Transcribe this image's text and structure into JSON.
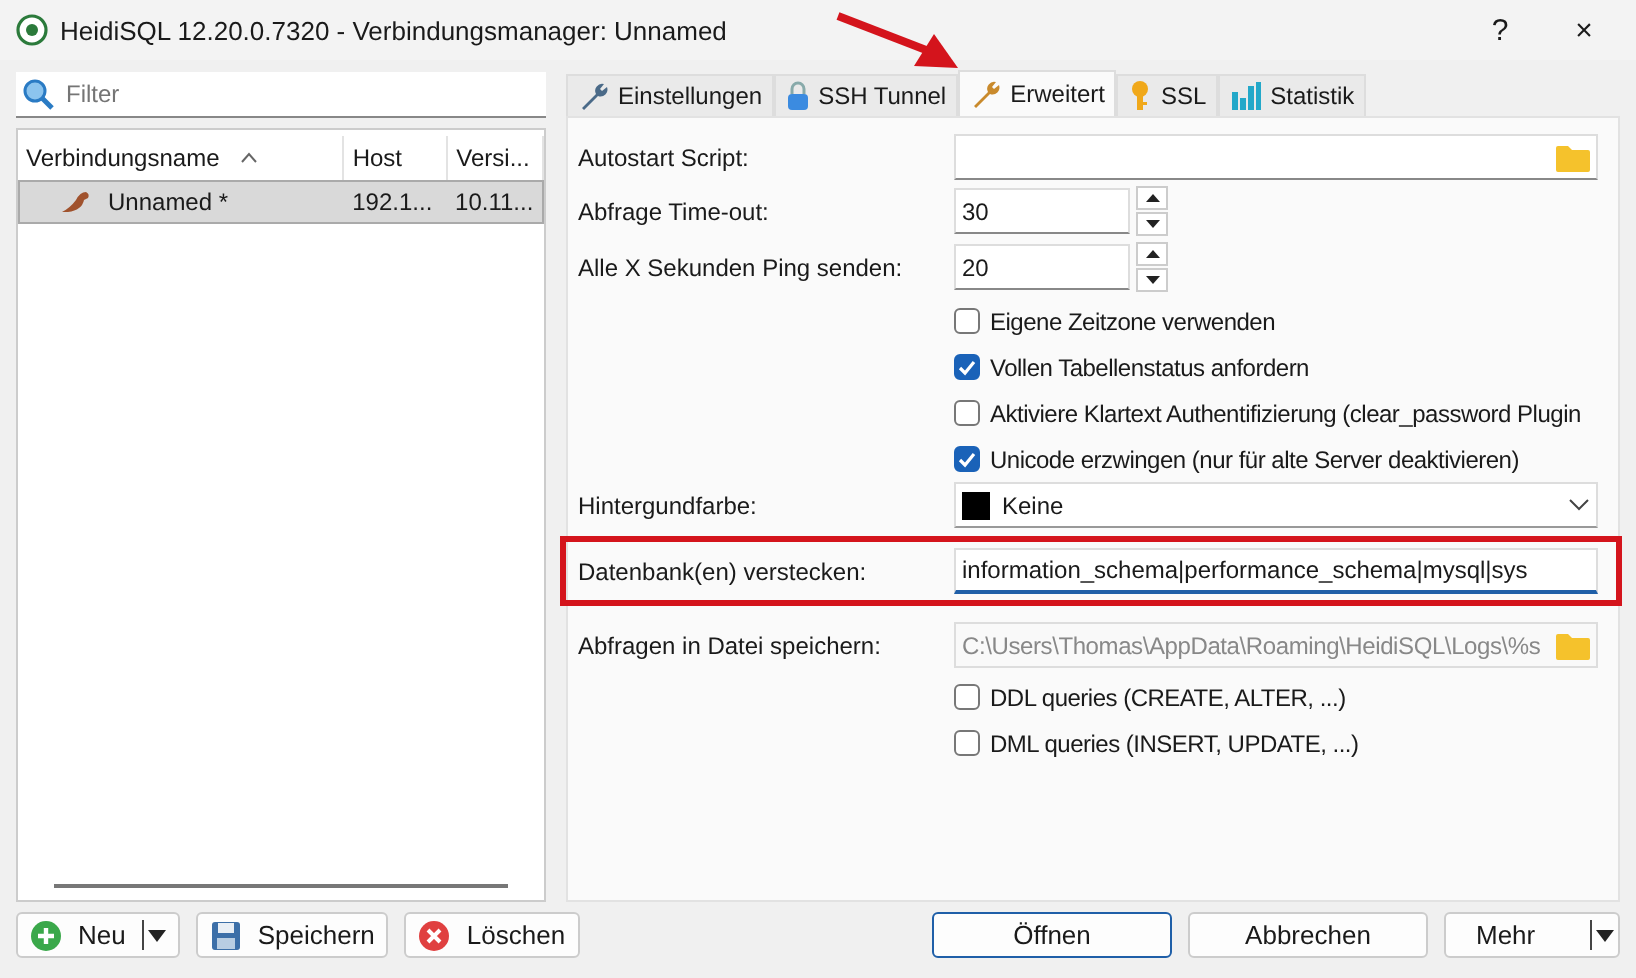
{
  "window": {
    "title": "HeidiSQL 12.20.0.7320 - Verbindungsmanager: Unnamed",
    "help": "?",
    "close": "×"
  },
  "sidebar": {
    "filter": {
      "placeholder": "Filter"
    },
    "columns": [
      {
        "label": "Verbindungsname",
        "sorted": true
      },
      {
        "label": "Host",
        "sorted": false
      },
      {
        "label": "Versi..."
      }
    ],
    "rows": [
      {
        "cells": [
          "Unnamed *",
          "192.1...",
          "10.11..."
        ],
        "selected": true
      }
    ]
  },
  "tabs": [
    {
      "label": "Einstellungen",
      "selected": false
    },
    {
      "label": "SSH Tunnel",
      "selected": false
    },
    {
      "label": "Erweitert",
      "selected": true
    },
    {
      "label": "SSL",
      "selected": false
    },
    {
      "label": "Statistik",
      "selected": false
    }
  ],
  "form": [
    {
      "kind": "file",
      "label": "Autostart Script:",
      "disabled": false
    },
    {
      "kind": "spin",
      "label": "Abfrage Time-out:",
      "value": "30"
    },
    {
      "kind": "spin",
      "label": "Alle X Sekunden Ping senden:",
      "value": "20"
    },
    {
      "kind": "check",
      "label": "Eigene Zeitzone verwenden",
      "checked": false
    },
    {
      "kind": "check",
      "label": "Vollen Tabellenstatus anfordern",
      "checked": true
    },
    {
      "kind": "check",
      "label": "Aktiviere Klartext Authentifizierung (clear_password Plugin",
      "checked": false
    },
    {
      "kind": "check",
      "label": "Unicode erzwingen (nur für alte Server deaktivieren)",
      "checked": true
    },
    {
      "kind": "color",
      "label": "Hintergundfarbe:",
      "value": "Keine",
      "color": "#000000"
    },
    {
      "kind": "text",
      "label": "Datenbank(en) verstecken:",
      "value": "information_schema|performance_schema|mysql|sys",
      "highlighted": true
    },
    {
      "kind": "file",
      "label": "Abfragen in Datei speichern:",
      "value": "C:\\Users\\Thomas\\AppData\\Roaming\\HeidiSQL\\Logs\\%s",
      "disabled": true
    },
    {
      "kind": "check",
      "label": "DDL queries (CREATE, ALTER, ...)",
      "checked": false
    },
    {
      "kind": "check",
      "label": "DML queries (INSERT, UPDATE, ...)",
      "checked": false
    }
  ],
  "left_buttons": [
    {
      "label": "Neu",
      "split": true
    },
    {
      "label": "Speichern",
      "split": false
    },
    {
      "label": "Löschen",
      "split": false
    }
  ],
  "right_buttons": [
    {
      "label": "Öffnen",
      "default": true,
      "split": false
    },
    {
      "label": "Abbrechen",
      "default": false,
      "split": false
    },
    {
      "label": "Mehr",
      "default": false,
      "split": true
    }
  ],
  "annotation": {
    "arrow": true
  }
}
